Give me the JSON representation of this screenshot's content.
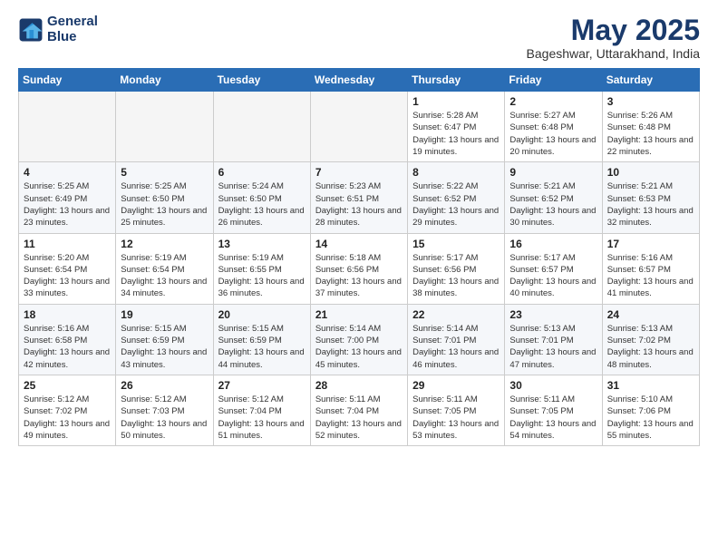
{
  "header": {
    "logo_line1": "General",
    "logo_line2": "Blue",
    "month": "May 2025",
    "location": "Bageshwar, Uttarakhand, India"
  },
  "weekdays": [
    "Sunday",
    "Monday",
    "Tuesday",
    "Wednesday",
    "Thursday",
    "Friday",
    "Saturday"
  ],
  "weeks": [
    [
      {
        "day": "",
        "empty": true
      },
      {
        "day": "",
        "empty": true
      },
      {
        "day": "",
        "empty": true
      },
      {
        "day": "",
        "empty": true
      },
      {
        "day": "1",
        "sunrise": "5:28 AM",
        "sunset": "6:47 PM",
        "daylight": "13 hours and 19 minutes."
      },
      {
        "day": "2",
        "sunrise": "5:27 AM",
        "sunset": "6:48 PM",
        "daylight": "13 hours and 20 minutes."
      },
      {
        "day": "3",
        "sunrise": "5:26 AM",
        "sunset": "6:48 PM",
        "daylight": "13 hours and 22 minutes."
      }
    ],
    [
      {
        "day": "4",
        "sunrise": "5:25 AM",
        "sunset": "6:49 PM",
        "daylight": "13 hours and 23 minutes."
      },
      {
        "day": "5",
        "sunrise": "5:25 AM",
        "sunset": "6:50 PM",
        "daylight": "13 hours and 25 minutes."
      },
      {
        "day": "6",
        "sunrise": "5:24 AM",
        "sunset": "6:50 PM",
        "daylight": "13 hours and 26 minutes."
      },
      {
        "day": "7",
        "sunrise": "5:23 AM",
        "sunset": "6:51 PM",
        "daylight": "13 hours and 28 minutes."
      },
      {
        "day": "8",
        "sunrise": "5:22 AM",
        "sunset": "6:52 PM",
        "daylight": "13 hours and 29 minutes."
      },
      {
        "day": "9",
        "sunrise": "5:21 AM",
        "sunset": "6:52 PM",
        "daylight": "13 hours and 30 minutes."
      },
      {
        "day": "10",
        "sunrise": "5:21 AM",
        "sunset": "6:53 PM",
        "daylight": "13 hours and 32 minutes."
      }
    ],
    [
      {
        "day": "11",
        "sunrise": "5:20 AM",
        "sunset": "6:54 PM",
        "daylight": "13 hours and 33 minutes."
      },
      {
        "day": "12",
        "sunrise": "5:19 AM",
        "sunset": "6:54 PM",
        "daylight": "13 hours and 34 minutes."
      },
      {
        "day": "13",
        "sunrise": "5:19 AM",
        "sunset": "6:55 PM",
        "daylight": "13 hours and 36 minutes."
      },
      {
        "day": "14",
        "sunrise": "5:18 AM",
        "sunset": "6:56 PM",
        "daylight": "13 hours and 37 minutes."
      },
      {
        "day": "15",
        "sunrise": "5:17 AM",
        "sunset": "6:56 PM",
        "daylight": "13 hours and 38 minutes."
      },
      {
        "day": "16",
        "sunrise": "5:17 AM",
        "sunset": "6:57 PM",
        "daylight": "13 hours and 40 minutes."
      },
      {
        "day": "17",
        "sunrise": "5:16 AM",
        "sunset": "6:57 PM",
        "daylight": "13 hours and 41 minutes."
      }
    ],
    [
      {
        "day": "18",
        "sunrise": "5:16 AM",
        "sunset": "6:58 PM",
        "daylight": "13 hours and 42 minutes."
      },
      {
        "day": "19",
        "sunrise": "5:15 AM",
        "sunset": "6:59 PM",
        "daylight": "13 hours and 43 minutes."
      },
      {
        "day": "20",
        "sunrise": "5:15 AM",
        "sunset": "6:59 PM",
        "daylight": "13 hours and 44 minutes."
      },
      {
        "day": "21",
        "sunrise": "5:14 AM",
        "sunset": "7:00 PM",
        "daylight": "13 hours and 45 minutes."
      },
      {
        "day": "22",
        "sunrise": "5:14 AM",
        "sunset": "7:01 PM",
        "daylight": "13 hours and 46 minutes."
      },
      {
        "day": "23",
        "sunrise": "5:13 AM",
        "sunset": "7:01 PM",
        "daylight": "13 hours and 47 minutes."
      },
      {
        "day": "24",
        "sunrise": "5:13 AM",
        "sunset": "7:02 PM",
        "daylight": "13 hours and 48 minutes."
      }
    ],
    [
      {
        "day": "25",
        "sunrise": "5:12 AM",
        "sunset": "7:02 PM",
        "daylight": "13 hours and 49 minutes."
      },
      {
        "day": "26",
        "sunrise": "5:12 AM",
        "sunset": "7:03 PM",
        "daylight": "13 hours and 50 minutes."
      },
      {
        "day": "27",
        "sunrise": "5:12 AM",
        "sunset": "7:04 PM",
        "daylight": "13 hours and 51 minutes."
      },
      {
        "day": "28",
        "sunrise": "5:11 AM",
        "sunset": "7:04 PM",
        "daylight": "13 hours and 52 minutes."
      },
      {
        "day": "29",
        "sunrise": "5:11 AM",
        "sunset": "7:05 PM",
        "daylight": "13 hours and 53 minutes."
      },
      {
        "day": "30",
        "sunrise": "5:11 AM",
        "sunset": "7:05 PM",
        "daylight": "13 hours and 54 minutes."
      },
      {
        "day": "31",
        "sunrise": "5:10 AM",
        "sunset": "7:06 PM",
        "daylight": "13 hours and 55 minutes."
      }
    ]
  ]
}
